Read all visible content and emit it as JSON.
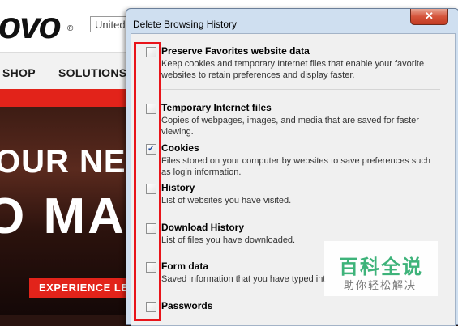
{
  "site": {
    "logo": "ovo",
    "logo_mark": "®",
    "region_select": "United",
    "nav": [
      "SHOP",
      "SOLUTIONS"
    ],
    "hero_line1": "OUR NEW",
    "hero_line2": "O MA",
    "cta": "EXPERIENCE LE"
  },
  "dialog": {
    "title": "Delete Browsing History",
    "close_symbol": "✕",
    "options": [
      {
        "title": "Preserve Favorites website data",
        "description": "Keep cookies and temporary Internet files that enable your favorite websites to retain preferences and display faster.",
        "checked": false
      },
      {
        "title": "Temporary Internet files",
        "description": "Copies of webpages, images, and media that are saved for faster viewing.",
        "checked": false
      },
      {
        "title": "Cookies",
        "description": "Files stored on your computer by websites to save preferences such as login information.",
        "checked": true
      },
      {
        "title": "History",
        "description": "List of websites you have visited.",
        "checked": false
      },
      {
        "title": "Download History",
        "description": "List of files you have downloaded.",
        "checked": false
      },
      {
        "title": "Form data",
        "description": "Saved information that you have typed int",
        "checked": false
      },
      {
        "title": "Passwords",
        "description": "",
        "checked": false
      }
    ]
  },
  "watermark": {
    "main": "百科全说",
    "sub": "助你轻松解决"
  },
  "colors": {
    "accent_red": "#e2231a",
    "highlight_red": "#e8141a",
    "dialog_frame": "#cfdff0",
    "watermark_green": "#3eb37a"
  }
}
